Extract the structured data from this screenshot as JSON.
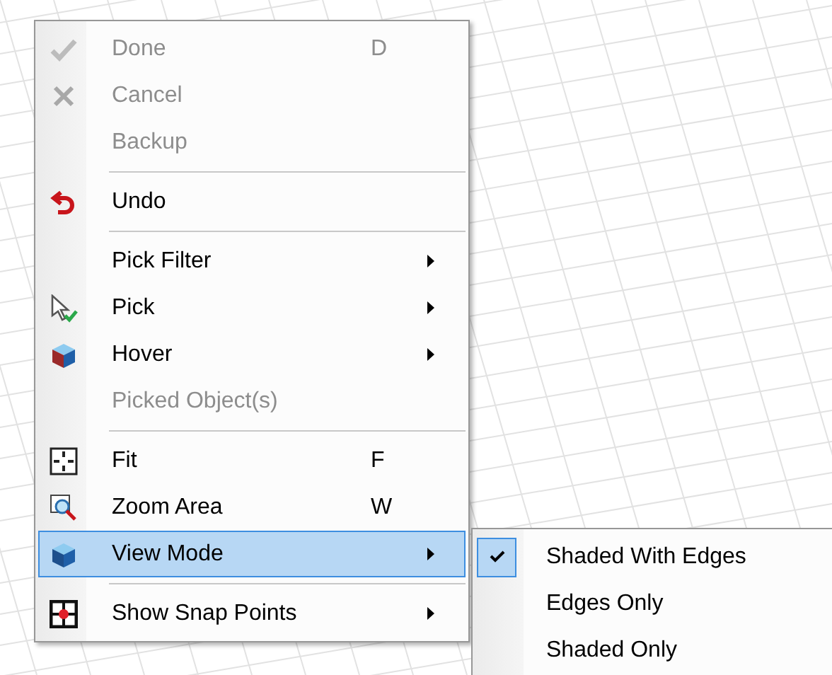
{
  "context_menu": {
    "items": [
      {
        "kind": "item",
        "label": "Done",
        "shortcut": "D",
        "disabled": true,
        "submenu": false,
        "selected": false
      },
      {
        "kind": "item",
        "label": "Cancel",
        "disabled": true,
        "submenu": false,
        "selected": false
      },
      {
        "kind": "item",
        "label": "Backup",
        "disabled": true,
        "submenu": false,
        "selected": false
      },
      {
        "kind": "separator"
      },
      {
        "kind": "item",
        "label": "Undo",
        "disabled": false,
        "submenu": false,
        "selected": false
      },
      {
        "kind": "separator"
      },
      {
        "kind": "item",
        "label": "Pick Filter",
        "disabled": false,
        "submenu": true,
        "selected": false
      },
      {
        "kind": "item",
        "label": "Pick",
        "disabled": false,
        "submenu": true,
        "selected": false
      },
      {
        "kind": "item",
        "label": "Hover",
        "disabled": false,
        "submenu": true,
        "selected": false
      },
      {
        "kind": "item",
        "label": "Picked Object(s)",
        "disabled": true,
        "submenu": false,
        "selected": false
      },
      {
        "kind": "separator"
      },
      {
        "kind": "item",
        "label": "Fit",
        "shortcut": "F",
        "disabled": false,
        "submenu": false,
        "selected": false
      },
      {
        "kind": "item",
        "label": "Zoom Area",
        "shortcut": "W",
        "disabled": false,
        "submenu": false,
        "selected": false
      },
      {
        "kind": "item",
        "label": "View Mode",
        "disabled": false,
        "submenu": true,
        "selected": true
      },
      {
        "kind": "separator"
      },
      {
        "kind": "item",
        "label": "Show Snap Points",
        "disabled": false,
        "submenu": true,
        "selected": false
      }
    ]
  },
  "submenu": {
    "items": [
      {
        "label": "Shaded With Edges",
        "checked": true
      },
      {
        "label": "Edges Only",
        "checked": false
      },
      {
        "label": "Shaded Only",
        "checked": false
      }
    ]
  }
}
